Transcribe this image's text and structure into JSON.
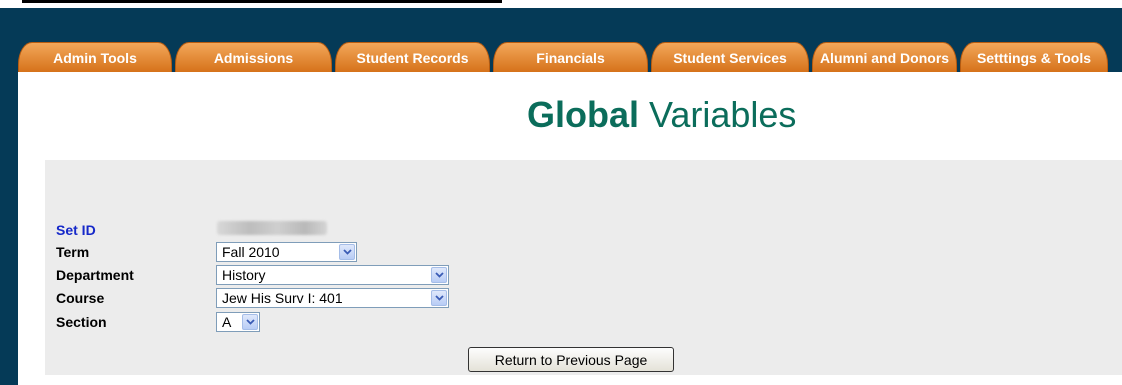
{
  "tabs": [
    {
      "label": "Admin Tools"
    },
    {
      "label": "Admissions"
    },
    {
      "label": "Student Records"
    },
    {
      "label": "Financials"
    },
    {
      "label": "Student Services"
    },
    {
      "label": "Alumni and Donors"
    },
    {
      "label": "Setttings & Tools"
    }
  ],
  "page": {
    "title_bold": "Global",
    "title_rest": " Variables"
  },
  "form": {
    "set_id_label": "Set ID",
    "term_label": "Term",
    "term_value": "Fall 2010",
    "department_label": "Department",
    "department_value": "History",
    "course_label": "Course",
    "course_value": "Jew His Surv I: 401",
    "section_label": "Section",
    "section_value": "A",
    "return_button": "Return to Previous Page"
  },
  "colors": {
    "frame": "#053a57",
    "tab": "#e38a34",
    "title": "#0b6d5b",
    "set_id_label": "#1528c9",
    "panel": "#ececec"
  },
  "icons": {
    "dropdown": "chevron-down-icon"
  }
}
